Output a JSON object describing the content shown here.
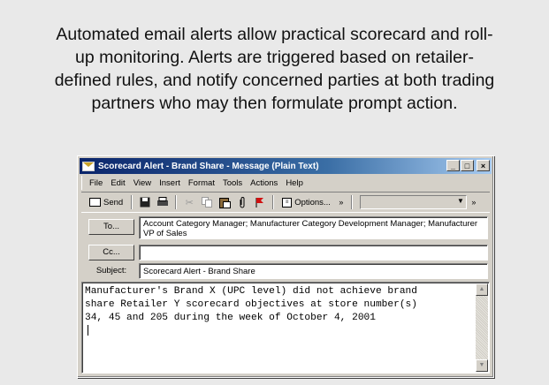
{
  "caption": {
    "lines": [
      "Automated email alerts allow practical scorecard and roll-",
      "up monitoring. Alerts are triggered based on retailer-",
      "defined rules, and notify concerned parties at both trading",
      "partners who may then formulate prompt action."
    ]
  },
  "window": {
    "title": "Scorecard Alert - Brand Share - Message (Plain Text)",
    "controls": {
      "minimize": "_",
      "maximize": "□",
      "close": "×"
    }
  },
  "menu": [
    "File",
    "Edit",
    "View",
    "Insert",
    "Format",
    "Tools",
    "Actions",
    "Help"
  ],
  "toolbar": {
    "send_label": "Send",
    "options_label": "Options...",
    "overflow": "»",
    "icons": [
      "save-icon",
      "print-icon",
      "cut-icon",
      "copy-icon",
      "paste-icon",
      "attach-icon",
      "flag-icon"
    ]
  },
  "fields": {
    "to_button": "To...",
    "to_value": "Account Category Manager; Manufacturer Category Development Manager; Manufacturer VP of Sales",
    "cc_button": "Cc...",
    "cc_value": "",
    "subject_label": "Subject:",
    "subject_value": "Scorecard Alert - Brand Share"
  },
  "message": {
    "lines": [
      "Manufacturer's Brand X (UPC level) did not achieve brand",
      "share Retailer Y scorecard objectives at store number(s)",
      "34, 45 and 205 during the week of October 4, 2001"
    ]
  }
}
